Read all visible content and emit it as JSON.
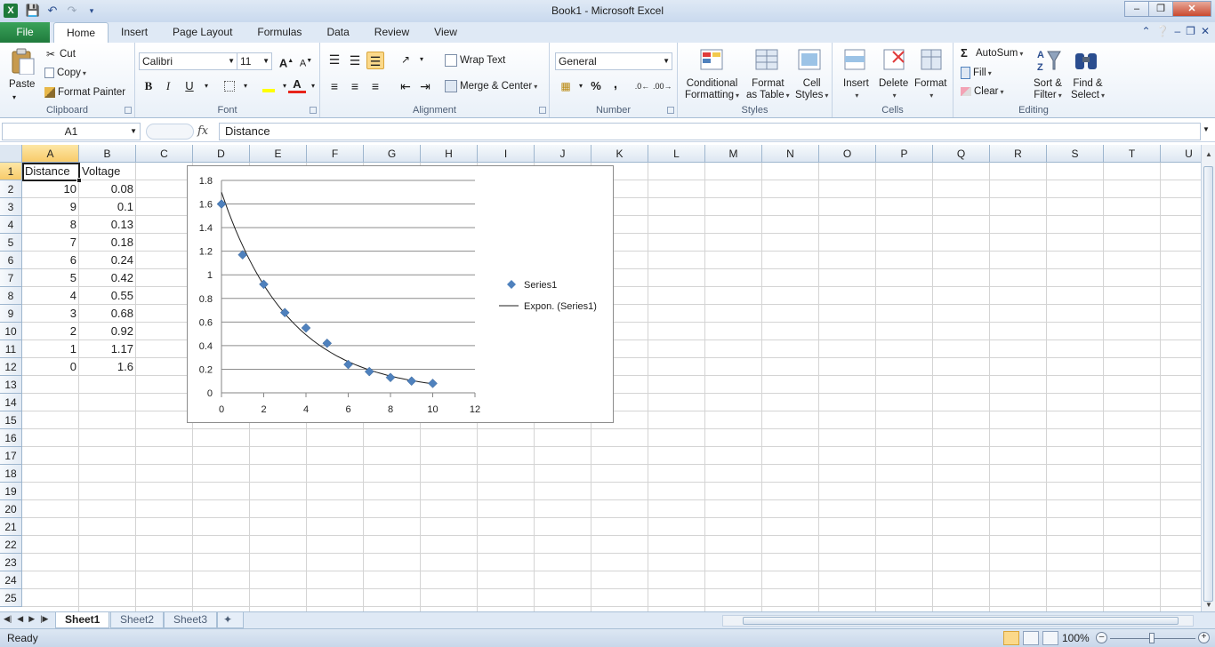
{
  "window": {
    "title": "Book1  -  Microsoft Excel",
    "app_icon": "X"
  },
  "ribbon_tabs": {
    "file": "File",
    "items": [
      "Home",
      "Insert",
      "Page Layout",
      "Formulas",
      "Data",
      "Review",
      "View"
    ],
    "active": "Home"
  },
  "clipboard": {
    "paste": "Paste",
    "cut": "Cut",
    "copy": "Copy",
    "format_painter": "Format Painter",
    "label": "Clipboard"
  },
  "font": {
    "name": "Calibri",
    "size": "11",
    "bold": "B",
    "italic": "I",
    "underline": "U",
    "label": "Font"
  },
  "alignment": {
    "wrap_text": "Wrap Text",
    "merge_center": "Merge & Center",
    "label": "Alignment"
  },
  "number": {
    "format": "General",
    "percent": "%",
    "comma": ",",
    "label": "Number"
  },
  "styles": {
    "conditional": [
      "Conditional",
      "Formatting"
    ],
    "format_table": [
      "Format",
      "as Table"
    ],
    "cell_styles": [
      "Cell",
      "Styles"
    ],
    "label": "Styles"
  },
  "cells_group": {
    "insert": "Insert",
    "delete": "Delete",
    "format": "Format",
    "label": "Cells"
  },
  "editing": {
    "autosum": "AutoSum",
    "fill": "Fill",
    "clear": "Clear",
    "sort": [
      "Sort &",
      "Filter"
    ],
    "find": [
      "Find &",
      "Select"
    ],
    "label": "Editing"
  },
  "formula_bar": {
    "name_box": "A1",
    "fx": "fx",
    "content": "Distance"
  },
  "grid": {
    "columns": [
      "A",
      "B",
      "C",
      "D",
      "E",
      "F",
      "G",
      "H",
      "I",
      "J",
      "K",
      "L",
      "M",
      "N",
      "O",
      "P",
      "Q",
      "R",
      "S",
      "T",
      "U"
    ],
    "rows": [
      "1",
      "2",
      "3",
      "4",
      "5",
      "6",
      "7",
      "8",
      "9",
      "10",
      "11",
      "12",
      "13",
      "14",
      "15",
      "16",
      "17",
      "18",
      "19",
      "20",
      "21",
      "22",
      "23",
      "24",
      "25"
    ],
    "headers": [
      "Distance",
      "Voltage"
    ],
    "data": [
      [
        "10",
        "0.08"
      ],
      [
        "9",
        "0.1"
      ],
      [
        "8",
        "0.13"
      ],
      [
        "7",
        "0.18"
      ],
      [
        "6",
        "0.24"
      ],
      [
        "5",
        "0.42"
      ],
      [
        "4",
        "0.55"
      ],
      [
        "3",
        "0.68"
      ],
      [
        "2",
        "0.92"
      ],
      [
        "1",
        "1.17"
      ],
      [
        "0",
        "1.6"
      ]
    ]
  },
  "chart_data": {
    "type": "scatter",
    "series": [
      {
        "name": "Series1",
        "x": [
          10,
          9,
          8,
          7,
          6,
          5,
          4,
          3,
          2,
          1,
          0
        ],
        "y": [
          0.08,
          0.1,
          0.13,
          0.18,
          0.24,
          0.42,
          0.55,
          0.68,
          0.92,
          1.17,
          1.6
        ],
        "color": "#4f81bd",
        "marker": "diamond"
      }
    ],
    "trendline": {
      "name": "Expon. (Series1)",
      "type": "exponential",
      "a": 1.7,
      "b": -0.31,
      "x_range": [
        0,
        10
      ]
    },
    "xlim": [
      0,
      12
    ],
    "ylim": [
      0,
      1.8
    ],
    "x_ticks": [
      "0",
      "2",
      "4",
      "6",
      "8",
      "10",
      "12"
    ],
    "y_ticks": [
      "0",
      "0.2",
      "0.4",
      "0.6",
      "0.8",
      "1",
      "1.2",
      "1.4",
      "1.6",
      "1.8"
    ],
    "grid": "horizontal",
    "legend_position": "right"
  },
  "sheets": {
    "tabs": [
      "Sheet1",
      "Sheet2",
      "Sheet3"
    ],
    "active": "Sheet1"
  },
  "status": {
    "ready": "Ready",
    "zoom": "100%"
  }
}
